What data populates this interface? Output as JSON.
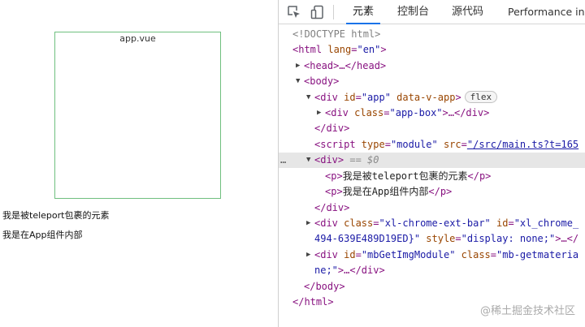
{
  "page": {
    "box_title": "app.vue",
    "teleport_text": "我是被teleport包裹的元素",
    "inner_text": "我是在App组件内部"
  },
  "toolbar": {
    "inspect_icon": "inspect-element-icon",
    "device_icon": "device-toolbar-icon",
    "tabs": [
      {
        "label": "元素",
        "active": true
      },
      {
        "label": "控制台",
        "active": false
      },
      {
        "label": "源代码",
        "active": false
      },
      {
        "label": "Performance ins",
        "active": false
      }
    ]
  },
  "dom": {
    "doctype": "<!DOCTYPE html>",
    "html_open_tag": "<html",
    "html_attr": " lang",
    "html_val": "\"en\"",
    "head": "<head>…</head>",
    "body_open": "<body>",
    "div_app_tag": "<div",
    "div_app_attr1": " id",
    "div_app_val1": "\"app\"",
    "div_app_attr2": " data-v-app",
    "div_app_close": ">",
    "flex_badge": "flex",
    "app_box_tag": "<div",
    "app_box_attr": " class",
    "app_box_val": "\"app-box\"",
    "app_box_rest": ">…</div>",
    "div_close": "</div>",
    "script_tag": "<script",
    "script_attr1": " type",
    "script_val1": "\"module\"",
    "script_attr2": " src",
    "script_val2": "\"/src/main.ts?t=165",
    "sel_div": "<div>",
    "sel_marker": " == $0",
    "p1_open": "<p>",
    "p1_text": "我是被teleport包裹的元素",
    "p1_close": "</p>",
    "p2_open": "<p>",
    "p2_text": "我是在App组件内部",
    "p2_close": "</p>",
    "div_close2": "</div>",
    "xl_tag": "<div",
    "xl_attr1": " class",
    "xl_val1": "\"xl-chrome-ext-bar\"",
    "xl_attr2": " id",
    "xl_val2": "\"xl_chrome_",
    "xl_cont_val": "494-639E489D19ED}\"",
    "xl_cont_attr": " style",
    "xl_cont_val2": "\"display: none;\"",
    "xl_cont_rest": ">…</",
    "mb_tag": "<div",
    "mb_attr1": " id",
    "mb_val1": "\"mbGetImgModule\"",
    "mb_attr2": " class",
    "mb_val2": "\"mb-getmateria",
    "mb_cont_val": "ne;\"",
    "mb_cont_rest": ">…</div>",
    "body_close": "</body>",
    "html_close": "</html>",
    "ellipsis": "…"
  },
  "watermark": "@稀土掘金技术社区",
  "colors": {
    "tag": "#881280",
    "attr": "#994500",
    "value": "#1a1aa6",
    "selected_row": "#e6e6e6",
    "active_tab_underline": "#1a73e8",
    "box_border": "#6fbf7f"
  }
}
